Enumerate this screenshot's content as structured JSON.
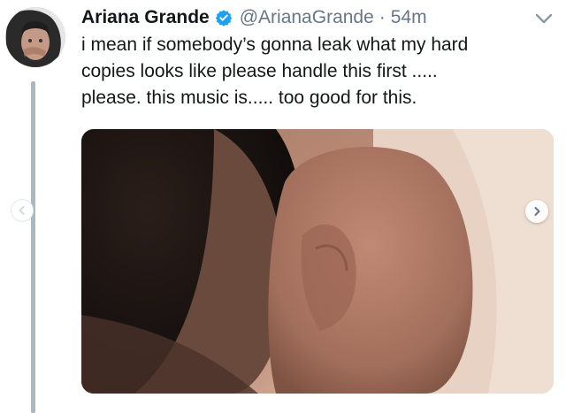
{
  "tweet": {
    "author_name": "Ariana Grande",
    "handle": "@ArianaGrande",
    "separator": "·",
    "time": "54m",
    "text_lines": [
      "i mean if somebody’s gonna leak what my hard",
      "copies looks like please handle this first .....",
      "please. this music is..... too good for this."
    ]
  },
  "icons": {
    "verified": "verified-badge-icon",
    "more": "chevron-down-icon",
    "prev": "chevron-left-icon",
    "next": "chevron-right-icon"
  },
  "colors": {
    "verified_blue": "#1da1f2",
    "secondary_text": "#657786",
    "thread_line": "#aab8c2"
  }
}
